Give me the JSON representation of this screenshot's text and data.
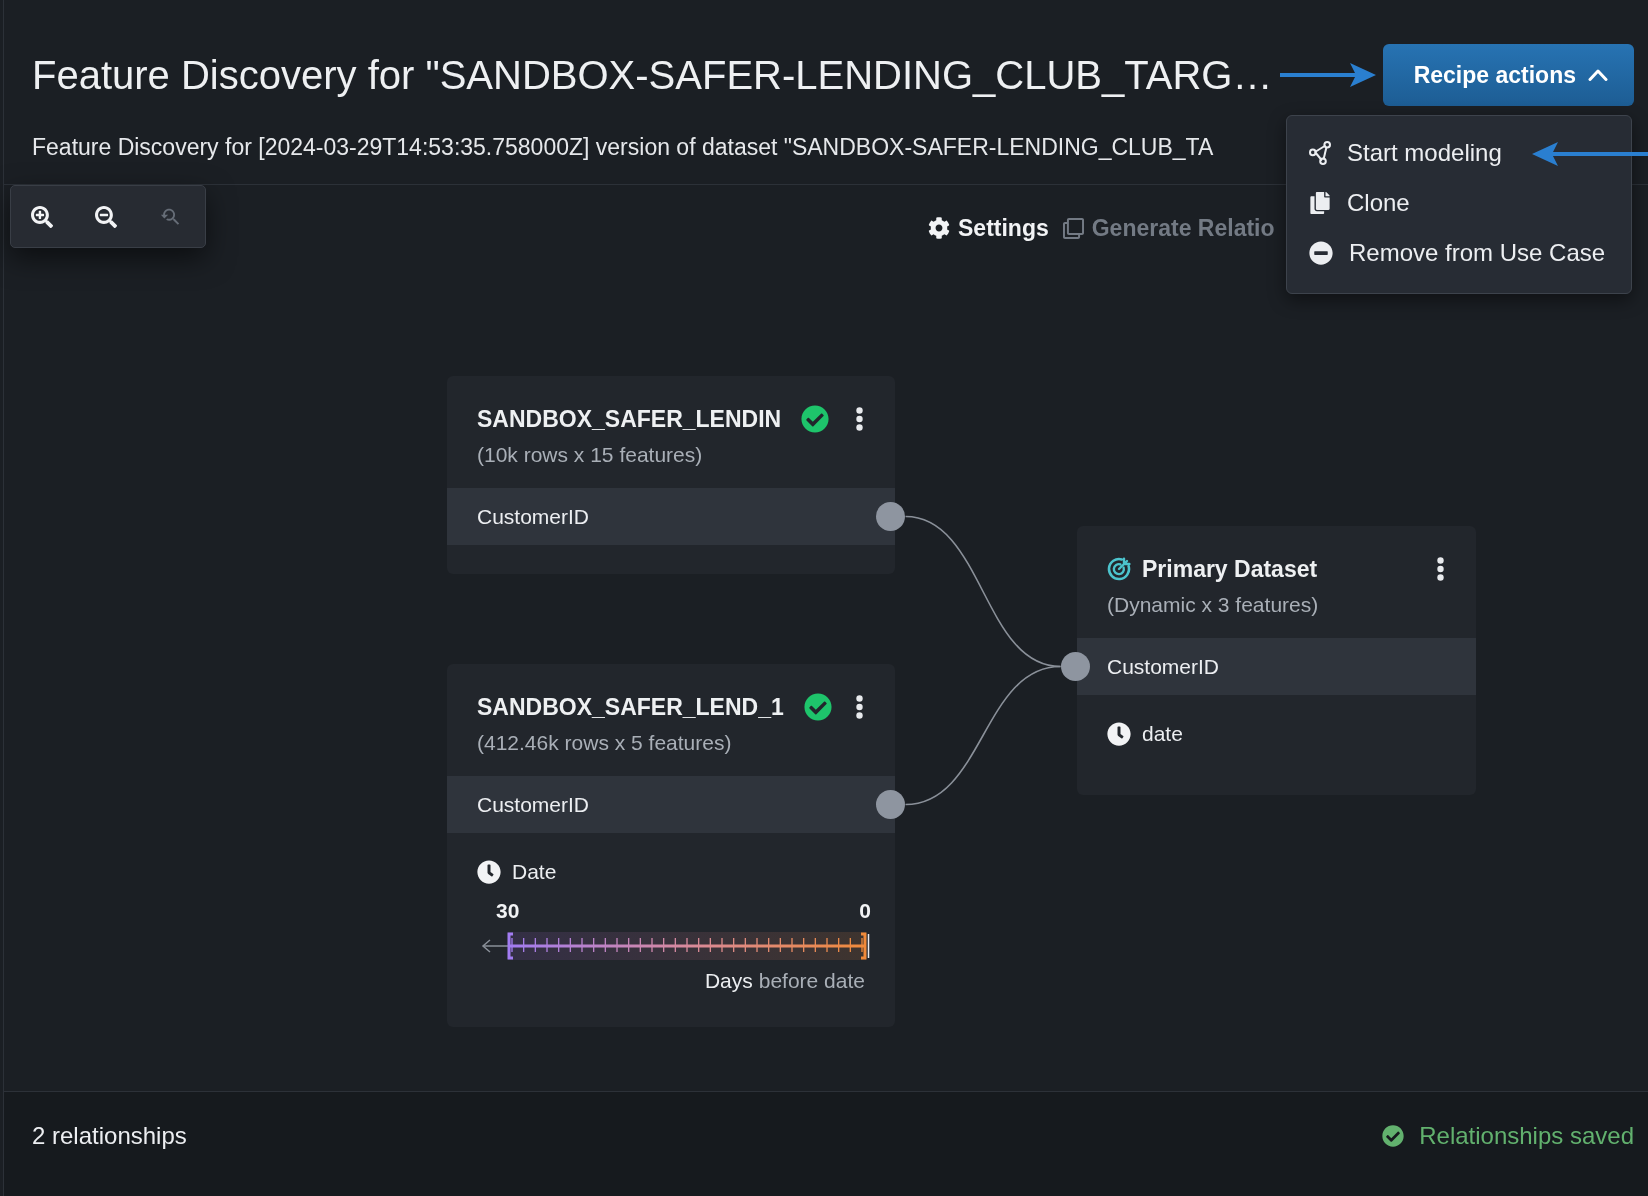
{
  "header": {
    "title": "Feature Discovery for \"SANDBOX-SAFER-LENDING_CLUB_TARG…",
    "subtitle": "Feature Discovery for [2024-03-29T14:53:35.758000Z] version of dataset \"SANDBOX-SAFER-LENDING_CLUB_TA",
    "recipe_actions": {
      "label": "Recipe actions",
      "expanded": true
    }
  },
  "recipe_menu": [
    {
      "kind": "model",
      "label": "Start modeling"
    },
    {
      "kind": "clone",
      "label": "Clone"
    },
    {
      "kind": "remove",
      "label": "Remove from Use Case"
    }
  ],
  "zoom_controls": [
    {
      "kind": "in",
      "disabled": false
    },
    {
      "kind": "out",
      "disabled": false
    },
    {
      "kind": "reset",
      "disabled": true
    }
  ],
  "canvas_actions": [
    {
      "kind": "settings",
      "label": "Settings",
      "disabled": false
    },
    {
      "kind": "generate",
      "label": "Generate Relatio",
      "disabled": true
    }
  ],
  "datasets": [
    {
      "kind": "secondary",
      "title": "SANDBOX_SAFER_LENDIN",
      "subtitle": "(10k rows x 15 features)",
      "valid": true,
      "fields": [
        {
          "kind": "key",
          "label": "CustomerID"
        }
      ]
    },
    {
      "kind": "secondary",
      "title": "SANDBOX_SAFER_LEND_1",
      "subtitle": "(412.46k rows x 5 features)",
      "valid": true,
      "fields": [
        {
          "kind": "key",
          "label": "CustomerID"
        },
        {
          "kind": "date",
          "label": "Date"
        }
      ],
      "time_window": {
        "from": "30",
        "to": "0",
        "unit": "Days",
        "suffix": "before date"
      }
    },
    {
      "kind": "primary",
      "title": "Primary Dataset",
      "subtitle": "(Dynamic x 3 features)",
      "fields": [
        {
          "kind": "key",
          "label": "CustomerID"
        },
        {
          "kind": "date",
          "label": "date"
        }
      ]
    }
  ],
  "footer": {
    "relationships": "2 relationships",
    "save_status": {
      "label": "Relationships saved",
      "saved": true
    }
  }
}
